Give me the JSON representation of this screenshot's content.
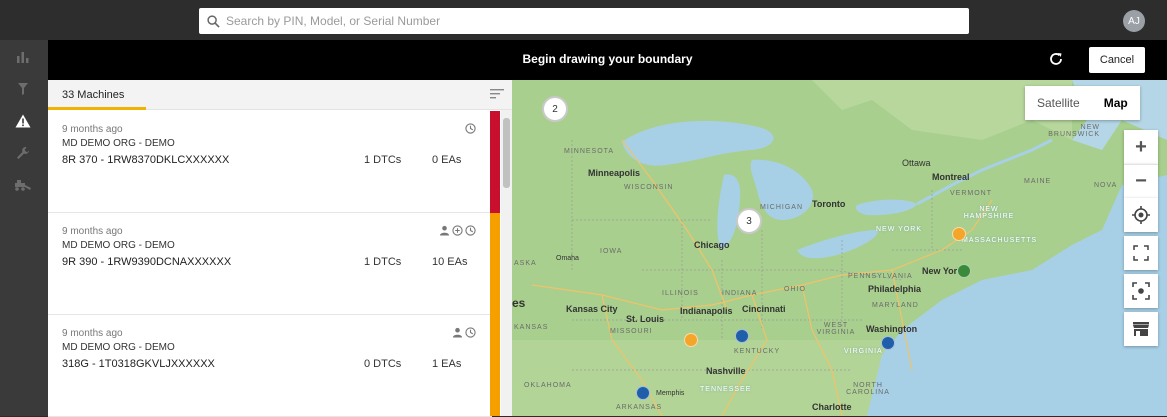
{
  "search": {
    "placeholder": "Search by PIN, Model, or Serial Number"
  },
  "user": {
    "initials": "AJ"
  },
  "rail": {
    "icons": [
      "bar-chart-icon",
      "filter-icon",
      "alert-icon",
      "wrench-icon",
      "machine-icon"
    ]
  },
  "banner": {
    "message": "Begin drawing your boundary",
    "cancel_label": "Cancel"
  },
  "list": {
    "count_label": "33 Machines",
    "items": [
      {
        "time": "9 months ago",
        "org": "MD DEMO ORG - DEMO",
        "machine": "8R 370 - 1RW8370DKLCXXXXXX",
        "dtcs": "1 DTCs",
        "eas": "0 EAs",
        "status_color": "#c8102e",
        "icons": [
          "clock-icon"
        ]
      },
      {
        "time": "9 months ago",
        "org": "MD DEMO ORG - DEMO",
        "machine": "9R 390 - 1RW9390DCNAXXXXXX",
        "dtcs": "1 DTCs",
        "eas": "10 EAs",
        "status_color": "#f5a000",
        "icons": [
          "person-icon",
          "plus-circle-icon",
          "clock-icon"
        ]
      },
      {
        "time": "9 months ago",
        "org": "MD DEMO ORG - DEMO",
        "machine": "318G - 1T0318GKVLJXXXXXX",
        "dtcs": "0 DTCs",
        "eas": "1 EAs",
        "status_color": "#f5a000",
        "icons": [
          "person-icon",
          "clock-icon"
        ]
      }
    ]
  },
  "map": {
    "type_satellite": "Satellite",
    "type_map": "Map",
    "zoom_in": "+",
    "zoom_out": "−",
    "clusters": [
      "2",
      "3"
    ],
    "labels": {
      "minnesota": "MINNESOTA",
      "minneapolis": "Minneapolis",
      "wisconsin": "WISCONSIN",
      "michigan": "MICHIGAN",
      "toronto": "Toronto",
      "ottawa": "Ottawa",
      "montreal": "Montreal",
      "new_brunswick": "NEW BRUNSWICK",
      "vermont": "VERMONT",
      "maine": "MAINE",
      "nova": "NOVA",
      "new_hampshire": "NEW HAMPSHIRE",
      "new_york_state": "NEW YORK",
      "massachusetts": "MASSACHUSETTS",
      "new_york": "New York",
      "chicago": "Chicago",
      "iowa": "IOWA",
      "omaha": "Omaha",
      "aska": "ASKA",
      "pennsylvania": "PENNSYLVANIA",
      "philadelphia": "Philadelphia",
      "illinois": "ILLINOIS",
      "indiana": "INDIANA",
      "ohio": "OHIO",
      "kansas_city": "Kansas City",
      "indianapolis": "Indianapolis",
      "cincinnati": "Cincinnati",
      "maryland": "MARYLAND",
      "st_louis": "St. Louis",
      "kansas": "KANSAS",
      "missouri": "MISSOURI",
      "west_virginia": "WEST VIRGINIA",
      "washington": "Washington",
      "kentucky": "KENTUCKY",
      "virginia": "VIRGINIA",
      "nashville": "Nashville",
      "oklahoma": "OKLAHOMA",
      "memphis": "Memphis",
      "tennessee": "TENNESSEE",
      "north_carolina": "NORTH CAROLINA",
      "arkansas": "ARKANSAS",
      "charlotte": "Charlotte",
      "es": "es"
    },
    "colors": {
      "orange": "#f4a62a",
      "blue": "#1f5ea8",
      "green": "#3a8a3a"
    }
  }
}
